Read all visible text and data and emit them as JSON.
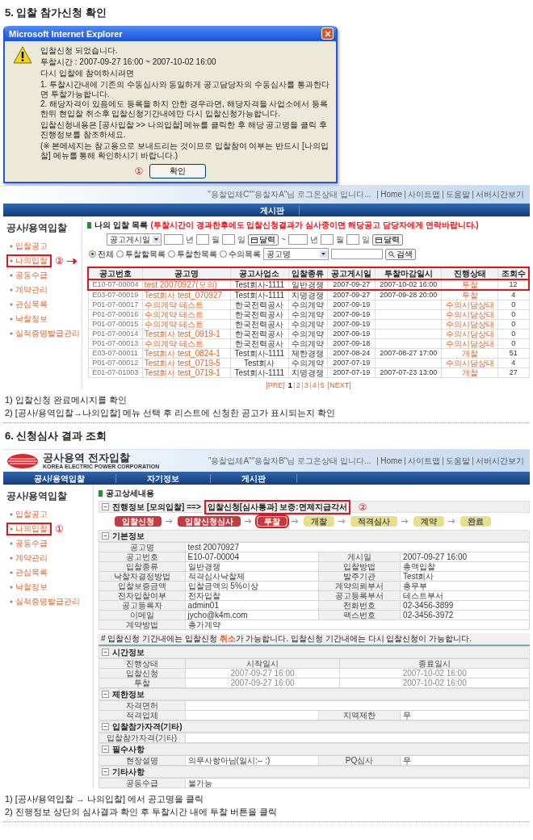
{
  "section_1": {
    "title": "5. 입찰 참가신청 확인",
    "dialog": {
      "title": "Microsoft Internet Explorer",
      "message": "입찰신청 되었습니다.",
      "bid_time": "투찰시간 : 2007-09-27 16:00 ~ 2007-10-02 16:00",
      "lead": "다시 입찰에 참여하시려면",
      "steps": [
        "1. 투찰시간내에 기존의 수동심사와 동일하게 공고담당자의 수동심사를 통과한다면 투찰가능합니다.",
        "2. 해당자격이 있음에도 등록을 하지 안한 경우라면, 해당자격을 사업소에서 등록한뒤 현입찰 취소후 입찰신청기간내에만 다시 입찰신청가능합니다."
      ],
      "guide": "입찰신청내용은 [공사입찰 >> 나의입찰] 메뉴를 클릭한 후 해당 공고명을 클릭 후 진행정보를 참조하세요.",
      "footnote": "(※ 본메세지는 참고용으로 보내드리는 것이므로 입찰참여 여부는 반드시 [나의입찰] 메뉴를 통해 확인하시기 바랍니다.)",
      "marker": "①",
      "button": "확인"
    },
    "page": {
      "login_text": "\"응찰업체C\"\"응찰자A\"님 로그온상태 입니다...",
      "links": [
        "Home",
        "사이트맵",
        "도움말",
        "서버시간보기"
      ],
      "nav": [
        "게시판"
      ],
      "sidebar": {
        "title": "공사/용역입찰",
        "items": [
          {
            "label": "입찰공고",
            "highlighted": false
          },
          {
            "label": "나의입찰",
            "highlighted": true,
            "marker": "②"
          },
          {
            "label": "공동수급",
            "highlighted": false
          },
          {
            "label": "계약관리",
            "highlighted": false
          },
          {
            "label": "관심목록",
            "highlighted": false
          },
          {
            "label": "낙찰정보",
            "highlighted": false
          },
          {
            "label": "실적증명발급관리",
            "highlighted": false
          }
        ]
      },
      "list": {
        "title": "나의 입찰 목록",
        "notice": "(투찰시간이 경과한후에도 입찰신청결과가 심사중이면 해당공고 담당자에게 연락바랍니다.)",
        "date_filter": {
          "field": "공고게시일",
          "ranges": [
            {
              "units": [
                "년",
                "월",
                "일"
              ],
              "button": "달력"
            },
            {
              "units": [
                "년",
                "월",
                "일"
              ],
              "button": "달력"
            }
          ],
          "separator": "~"
        },
        "scope_filter": {
          "options": [
            {
              "label": "전체",
              "selected": true
            },
            {
              "label": "투찰할목록",
              "selected": false
            },
            {
              "label": "투찰한목록",
              "selected": false
            },
            {
              "label": "수의목록",
              "selected": false
            }
          ],
          "field": "공고명",
          "button": "검색"
        },
        "header_highlighted": true,
        "columns": [
          "공고번호",
          "공고명",
          "공고사업소",
          "입찰종류",
          "공고게시일",
          "투찰마감일시",
          "진행상태",
          "조회수"
        ],
        "rows": [
          {
            "number": "E10-07-00004",
            "title": "test 20070927(모의)",
            "office": "Test회사-1111",
            "type": "일반경쟁",
            "posted": "2007-09-27",
            "deadline": "2007-10-02 16:00",
            "status": "투찰",
            "views": "12",
            "highlighted": true
          },
          {
            "number": "E03-07-00019",
            "title": "Test회사 test_070927",
            "office": "Test회사-1111",
            "type": "지명경쟁",
            "posted": "2007-09-27",
            "deadline": "2007-09-28 20:00",
            "status": "투찰",
            "views": "4",
            "highlighted": false
          },
          {
            "number": "P01-07-00017",
            "title": "수의계약 테스트",
            "office": "한국전력공사",
            "type": "수의계약",
            "posted": "2007-09-19",
            "status": "수의시담상태",
            "views": "0",
            "highlighted": false
          },
          {
            "number": "P01-07-00016",
            "title": "수의계약 테스트",
            "office": "한국전력공사",
            "type": "수의계약",
            "posted": "2007-09-19",
            "status": "수의시담상태",
            "views": "0",
            "highlighted": false
          },
          {
            "number": "P01-07-00015",
            "title": "수의계약 테스트",
            "office": "한국전력공사",
            "type": "수의계약",
            "posted": "2007-09-19",
            "status": "수의시담상태",
            "views": "0",
            "highlighted": false
          },
          {
            "number": "P01-07-00014",
            "title": "Test회사 test_0919-1",
            "office": "한국전력공사",
            "type": "수의계약",
            "posted": "2007-09-19",
            "status": "수의시담상태",
            "views": "0",
            "highlighted": false
          },
          {
            "number": "P01-07-00013",
            "title": "수의계약 테스트",
            "office": "한국전력공사",
            "type": "수의계약",
            "posted": "2007-09-18",
            "status": "수의시담상태",
            "views": "0",
            "highlighted": false
          },
          {
            "number": "E03-07-00011",
            "title": "Test회사 test_0824-1",
            "office": "Test회사-1111",
            "type": "제한경쟁",
            "posted": "2007-08-24",
            "deadline": "2007-08-27 17:00",
            "status": "개찰",
            "views": "51",
            "highlighted": false
          },
          {
            "number": "P01-07-00012",
            "title": "Test회사 test_0719-5",
            "office": "Test회사",
            "type": "수의계약",
            "posted": "2007-07-19",
            "status": "수의시담상태",
            "views": "4",
            "highlighted": false
          },
          {
            "number": "E01-07-01003",
            "title": "Test회사 test_0719-1",
            "office": "Test회사-1111",
            "type": "지명경쟁",
            "posted": "2007-07-19",
            "deadline": "2007-07-23 13:00",
            "status": "개찰",
            "views": "27",
            "highlighted": false
          }
        ],
        "pagination": {
          "prev": "[PRE]",
          "pages": [
            {
              "label": "1",
              "selected": true
            },
            {
              "label": "2",
              "selected": false
            },
            {
              "label": "3",
              "selected": false
            },
            {
              "label": "4",
              "selected": false
            },
            {
              "label": "5",
              "selected": false
            }
          ],
          "next": "[NEXT]"
        }
      }
    },
    "notes": [
      "1) 입찰신청 완료메시지를 확인",
      "2) [공사/용역입찰→나의입찰] 메뉴 선택 후 리스트에 신청한 공고가 표시되는지 확인"
    ]
  },
  "section_2": {
    "title": "6. 신청심사 결과 조회",
    "page": {
      "logo": {
        "title": "공사용역 전자입찰",
        "subtitle": "KOREA ELECTRIC POWER CORPORATION"
      },
      "login_text": "\"응찰업체A\"\"응찰자B\"님 로그온상태 입니다...",
      "links": [
        "Home",
        "사이트맵",
        "도움말",
        "서버시간보기"
      ],
      "nav": [
        "공사/용역입찰",
        "자기정보",
        "게시판"
      ],
      "sidebar": {
        "title": "공사/용역입찰",
        "items": [
          {
            "label": "입찰공고",
            "highlighted": false
          },
          {
            "label": "나의입찰",
            "highlighted": true,
            "marker": "①"
          },
          {
            "label": "공동수급",
            "highlighted": false
          },
          {
            "label": "계약관리",
            "highlighted": false
          },
          {
            "label": "관심목록",
            "highlighted": false
          },
          {
            "label": "낙찰정보",
            "highlighted": false
          },
          {
            "label": "실적증명발급관리",
            "highlighted": false
          }
        ]
      },
      "detail": {
        "title": "공고상세내용",
        "progress": {
          "label": "진행정보 [모의입찰] ==>",
          "status": "입찰신청[심사통과] 보증:면제지급각서",
          "highlighted": true,
          "marker": "②"
        },
        "steps": [
          {
            "label": "입찰신청",
            "done": true,
            "highlighted": false
          },
          {
            "label": "입찰신청심사",
            "done": true,
            "highlighted": false
          },
          {
            "label": "투찰",
            "done": true,
            "highlighted": true
          },
          {
            "label": "개찰",
            "done": false,
            "highlighted": false
          },
          {
            "label": "적격심사",
            "done": false,
            "highlighted": false
          },
          {
            "label": "계약",
            "done": false,
            "highlighted": false
          },
          {
            "label": "완료",
            "done": false,
            "highlighted": false
          }
        ],
        "sections": [
          {
            "kind": "pairs",
            "title": "기본정보",
            "rows": [
              {
                "label": "공고명",
                "value": "test 20070927"
              },
              {
                "label": "공고번호",
                "value": "E10-07-00004",
                "label_2": "게시일",
                "value_2": "2007-09-27 16:00"
              },
              {
                "label": "입찰종류",
                "value": "일반경쟁",
                "label_2": "입찰방법",
                "value_2": "총액입찰"
              },
              {
                "label": "낙찰자결정방법",
                "value": "적격심사낙찰제",
                "label_2": "발주기관",
                "value_2": "Test회사"
              },
              {
                "label": "입찰보증금액",
                "value": "입찰금액의 5%이상",
                "label_2": "계약의뢰부서",
                "value_2": "총무부"
              },
              {
                "label": "전자입찰여부",
                "value": "전자입찰",
                "label_2": "공고등록부서",
                "value_2": "테스트부서"
              },
              {
                "label": "공고등록자",
                "value": "admin01",
                "label_2": "전화번호",
                "value_2": "02-3456-3899"
              },
              {
                "label": "이메일",
                "value": "jycho@k4m.com",
                "label_2": "팩스번호",
                "value_2": "02-3456-3972"
              },
              {
                "label": "계약방법",
                "value": "총가계약"
              }
            ]
          },
          {
            "kind": "notice",
            "text": "# 입찰신청 기간내에는 입찰신청 **취소**가 가능합니다.  입찰신청 기간내에는 다시 입찰신청이 가능합니다."
          },
          {
            "kind": "grid",
            "title": "시간정보",
            "columns": [
              "진행상태",
              "시작일시",
              "종료일시"
            ],
            "rows": [
              [
                "입찰신청",
                "2007-09-27 16:00",
                "2007-10-02 16:00"
              ],
              [
                "투찰",
                "2007-09-27 16:00",
                "2007-10-02 16:00"
              ]
            ]
          },
          {
            "kind": "pairs",
            "title": "제한정보",
            "rows": [
              {
                "label": "자격면허"
              },
              {
                "label": "적격업체",
                "label_2": "지역제한",
                "value_2": "무"
              }
            ]
          },
          {
            "kind": "pairs",
            "title": "입찰참가자격(기타)",
            "rows": [
              {
                "label": "입찰참가자격(기타)"
              }
            ]
          },
          {
            "kind": "pairs",
            "title": "필수사항",
            "rows": [
              {
                "label": "현장설명",
                "value": "의무사항아님(일시:-- :)",
                "label_2": "PQ심사",
                "value_2": "무"
              }
            ]
          },
          {
            "kind": "pairs",
            "title": "기타사항",
            "rows": [
              {
                "label": "공동수급",
                "value": "불가능"
              }
            ]
          }
        ]
      }
    },
    "notes": [
      "1) [공사/용역입찰 → 나의입찰] 에서 공고명을 클릭",
      "2) 진행정보 상단의 심사결과 확인 후 투찰시간 내에 투찰 버튼을 클릭"
    ]
  }
}
